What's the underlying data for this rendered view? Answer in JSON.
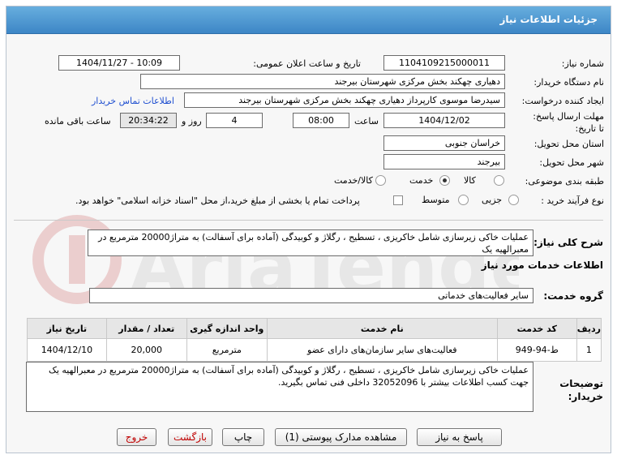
{
  "header": {
    "title": "جزئیات اطلاعات نیاز"
  },
  "fields": {
    "need_number_label": "شماره نیاز:",
    "need_number": "1104109215000011",
    "announce_label": "تاریخ و ساعت اعلان عمومی:",
    "announce_value": "1404/11/27 - 10:09",
    "buyer_org_label": "نام دستگاه خریدار:",
    "buyer_org": "دهیاری چهکند بخش مرکزی شهرستان بیرجند",
    "creator_label": "ایجاد کننده درخواست:",
    "creator": "سیدرضا موسوی کارپرداز دهیاری چهکند بخش مرکزی شهرستان بیرجند",
    "contact_link": "اطلاعات تماس خریدار",
    "deadline_label": "مهلت ارسال پاسخ: تا تاریخ:",
    "deadline_date": "1404/12/02",
    "time_label": "ساعت",
    "deadline_time": "08:00",
    "days_value": "4",
    "days_label": "روز و",
    "remaining_time": "20:34:22",
    "remaining_label": "ساعت باقی مانده",
    "province_label": "استان محل تحویل:",
    "province": "خراسان جنوبی",
    "city_label": "شهر محل تحویل:",
    "city": "بیرجند",
    "category_label": "طبقه بندی موضوعی:",
    "category_options": [
      "کالا",
      "خدمت",
      "کالا/خدمت"
    ],
    "category_selected": "خدمت",
    "purchase_type_label": "نوع فرآیند خرید :",
    "purchase_options": [
      "جزیی",
      "متوسط"
    ],
    "payment_note": "پرداخت تمام یا بخشی از مبلغ خرید،از محل \"اسناد خزانه اسلامی\" خواهد بود."
  },
  "summary": {
    "label": "شرح کلی نیاز:",
    "text": "عملیات خاکی زیرسازی شامل خاکریزی ، تسطیح ، رگلاژ و کوبیدگی (آماده برای آسفالت) به متراژ20000 مترمربع در معبرالهیه یک"
  },
  "services_section": {
    "title": "اطلاعات خدمات مورد نیاز",
    "group_label": "گروه خدمت:",
    "group_value": "سایر فعالیت‌های خدماتی"
  },
  "table": {
    "headers": [
      "ردیف",
      "کد خدمت",
      "نام خدمت",
      "واحد اندازه گیری",
      "تعداد / مقدار",
      "تاریخ نیاز"
    ],
    "rows": [
      [
        "1",
        "ط-94-949",
        "فعالیت‌های سایر سازمان‌های دارای عضو",
        "مترمربع",
        "20,000",
        "1404/12/10"
      ]
    ]
  },
  "buyer_notes": {
    "label": "توضیحات خریدار:",
    "text": "عملیات خاکی زیرسازی شامل خاکریزی ، تسطیح ، رگلاژ و کوبیدگی (آماده برای آسفالت) به متراژ20000 مترمربع در معبرالهیه یک جهت کسب اطلاعات بیشتر با 32052096 داخلی فنی تماس بگیرید."
  },
  "buttons": {
    "reply": "پاسخ به نیاز",
    "attachments": "مشاهده مدارک پیوستی (1)",
    "print": "چاپ",
    "back": "بازگشت",
    "exit": "خروج"
  },
  "watermark": {
    "brand": "AriaTender.net"
  },
  "colors": {
    "title_bar": "#3d86c6",
    "link": "#1f4fd0",
    "danger": "#c00000"
  }
}
